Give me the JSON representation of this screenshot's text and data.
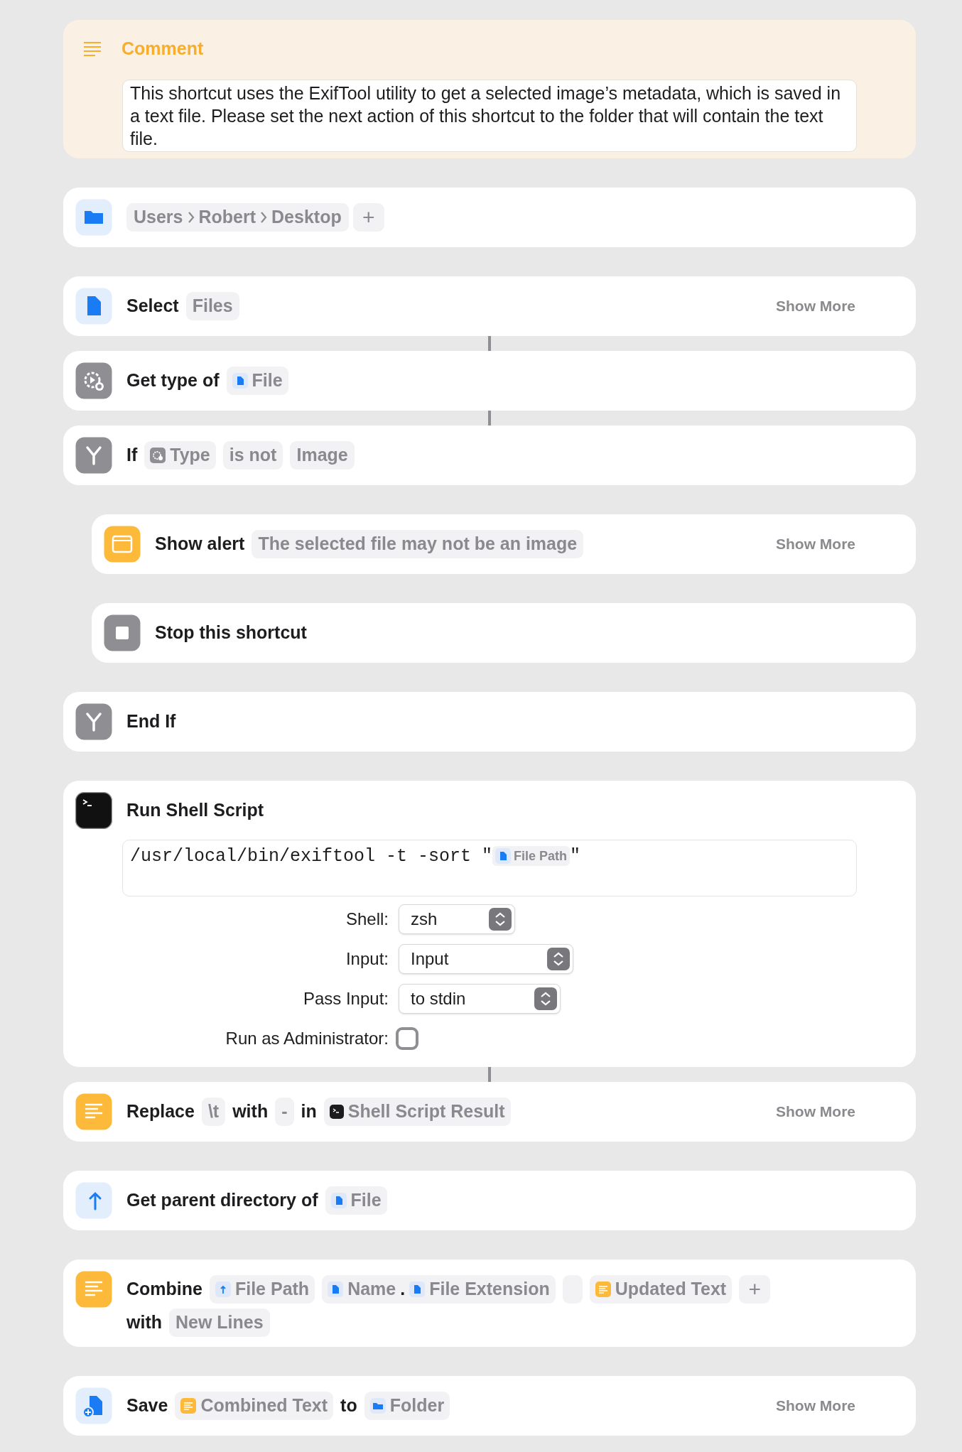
{
  "actions": [
    {
      "kind": "comment",
      "title": "Comment",
      "text": "This shortcut uses the ExifTool utility to get a selected image’s metadata, which is saved in a text file. Please set the next action of this shortcut to the folder that will contain the text file."
    },
    {
      "kind": "path",
      "indent": false,
      "connected": false,
      "segments": [
        "Users",
        "Robert",
        "Desktop"
      ],
      "add_button": "+"
    },
    {
      "kind": "select",
      "indent": false,
      "connected": false,
      "lines": [
        [
          {
            "kind": "word",
            "text": "Select"
          },
          {
            "kind": "plain",
            "text": "Files"
          }
        ]
      ],
      "show_more": "Show More"
    },
    {
      "kind": "get_type",
      "indent": false,
      "connected": true,
      "lines": [
        [
          {
            "kind": "word",
            "text": "Get type of"
          },
          {
            "kind": "file",
            "text": "File"
          }
        ]
      ]
    },
    {
      "kind": "if",
      "indent": false,
      "connected": true,
      "lines": [
        [
          {
            "kind": "word",
            "text": "If"
          },
          {
            "kind": "type",
            "text": "Type"
          },
          {
            "kind": "plain",
            "text": "is not"
          },
          {
            "kind": "plain",
            "text": "Image"
          }
        ]
      ]
    },
    {
      "kind": "alert",
      "indent": true,
      "connected": false,
      "lines": [
        [
          {
            "kind": "word",
            "text": "Show alert"
          },
          {
            "kind": "plain",
            "text": "The selected file may not be an image"
          }
        ]
      ],
      "show_more": "Show More"
    },
    {
      "kind": "stop",
      "indent": true,
      "connected": false,
      "lines": [
        [
          {
            "kind": "word",
            "text": "Stop this shortcut"
          }
        ]
      ]
    },
    {
      "kind": "end_if",
      "indent": false,
      "connected": false,
      "lines": [
        [
          {
            "kind": "word",
            "text": "End If"
          }
        ]
      ]
    },
    {
      "kind": "shell",
      "indent": false,
      "connected": false,
      "title": "Run Shell Script",
      "script": {
        "code": "/usr/local/bin/exiftool -t -sort \"",
        "token": {
          "kind": "file",
          "text": "File Path"
        },
        "code_end": "\""
      },
      "fields": [
        {
          "kind": "select",
          "label": "Shell:",
          "value": "zsh"
        },
        {
          "kind": "select",
          "label": "Input:",
          "value": "Input"
        },
        {
          "kind": "select",
          "label": "Pass Input:",
          "value": "to stdin"
        },
        {
          "kind": "checkbox",
          "label": "Run as Administrator:",
          "checked": false
        }
      ]
    },
    {
      "kind": "replace",
      "indent": false,
      "connected": true,
      "lines": [
        [
          {
            "kind": "word",
            "text": "Replace"
          },
          {
            "kind": "plain",
            "text": "\\t"
          },
          {
            "kind": "word",
            "text": "with"
          },
          {
            "kind": "plain",
            "text": "-"
          },
          {
            "kind": "word",
            "text": "in"
          },
          {
            "kind": "shell_result",
            "text": "Shell Script Result"
          }
        ]
      ],
      "show_more": "Show More"
    },
    {
      "kind": "parent",
      "indent": false,
      "connected": false,
      "lines": [
        [
          {
            "kind": "word",
            "text": "Get parent directory of"
          },
          {
            "kind": "file",
            "text": "File"
          }
        ]
      ]
    },
    {
      "kind": "combine",
      "indent": false,
      "connected": false,
      "lines": [
        [
          {
            "kind": "word",
            "text": "Combine"
          },
          {
            "kind": "parent",
            "text": "File Path"
          },
          {
            "kind": "group",
            "children": [
              {
                "kind": "file",
                "text": "Name"
              },
              {
                "kind": "dot",
                "text": "."
              },
              {
                "kind": "file",
                "text": "File Extension"
              }
            ]
          },
          {
            "kind": "empty"
          },
          {
            "kind": "text",
            "text": "Updated Text"
          },
          {
            "kind": "add",
            "text": "+"
          }
        ],
        [
          {
            "kind": "word",
            "text": "with"
          },
          {
            "kind": "plain",
            "text": "New Lines"
          }
        ]
      ]
    },
    {
      "kind": "save",
      "indent": false,
      "connected": false,
      "lines": [
        [
          {
            "kind": "word",
            "text": "Save"
          },
          {
            "kind": "text",
            "text": "Combined Text"
          },
          {
            "kind": "word",
            "text": "to"
          },
          {
            "kind": "folder",
            "text": "Folder"
          }
        ]
      ],
      "show_more": "Show More"
    }
  ]
}
